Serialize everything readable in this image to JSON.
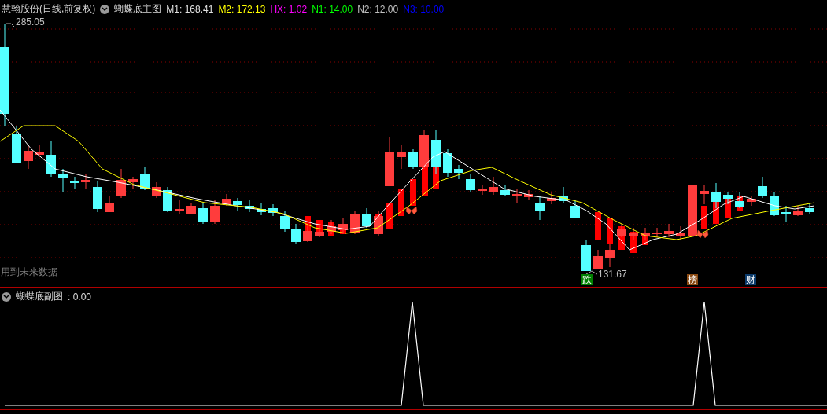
{
  "main_panel": {
    "stock_title": "慧翰股份(日线,前复权)",
    "indicator_name": "蝴蝶底主图",
    "indicators": [
      {
        "label": "M1:",
        "value": "168.41",
        "color": "#e0e0e0"
      },
      {
        "label": "M2:",
        "value": "172.13",
        "color": "#ffff00"
      },
      {
        "label": "HX:",
        "value": "1.02",
        "color": "#ff00ff"
      },
      {
        "label": "N1:",
        "value": "14.00",
        "color": "#00ff00"
      },
      {
        "label": "N2:",
        "value": "12.00",
        "color": "#c0c0c0"
      },
      {
        "label": "N3:",
        "value": "10.00",
        "color": "#0000ff"
      }
    ],
    "high_label": "285.05",
    "low_label": "131.67",
    "note": "用到未来数据",
    "badges": [
      {
        "text": "跌",
        "color": "#008000"
      },
      {
        "text": "榜",
        "color": "#8b4a12"
      },
      {
        "text": "财",
        "color": "#0a3a6a"
      }
    ]
  },
  "sub_panel": {
    "indicator_name": "蝴蝶底副图",
    "value": ": 0.00"
  }
}
